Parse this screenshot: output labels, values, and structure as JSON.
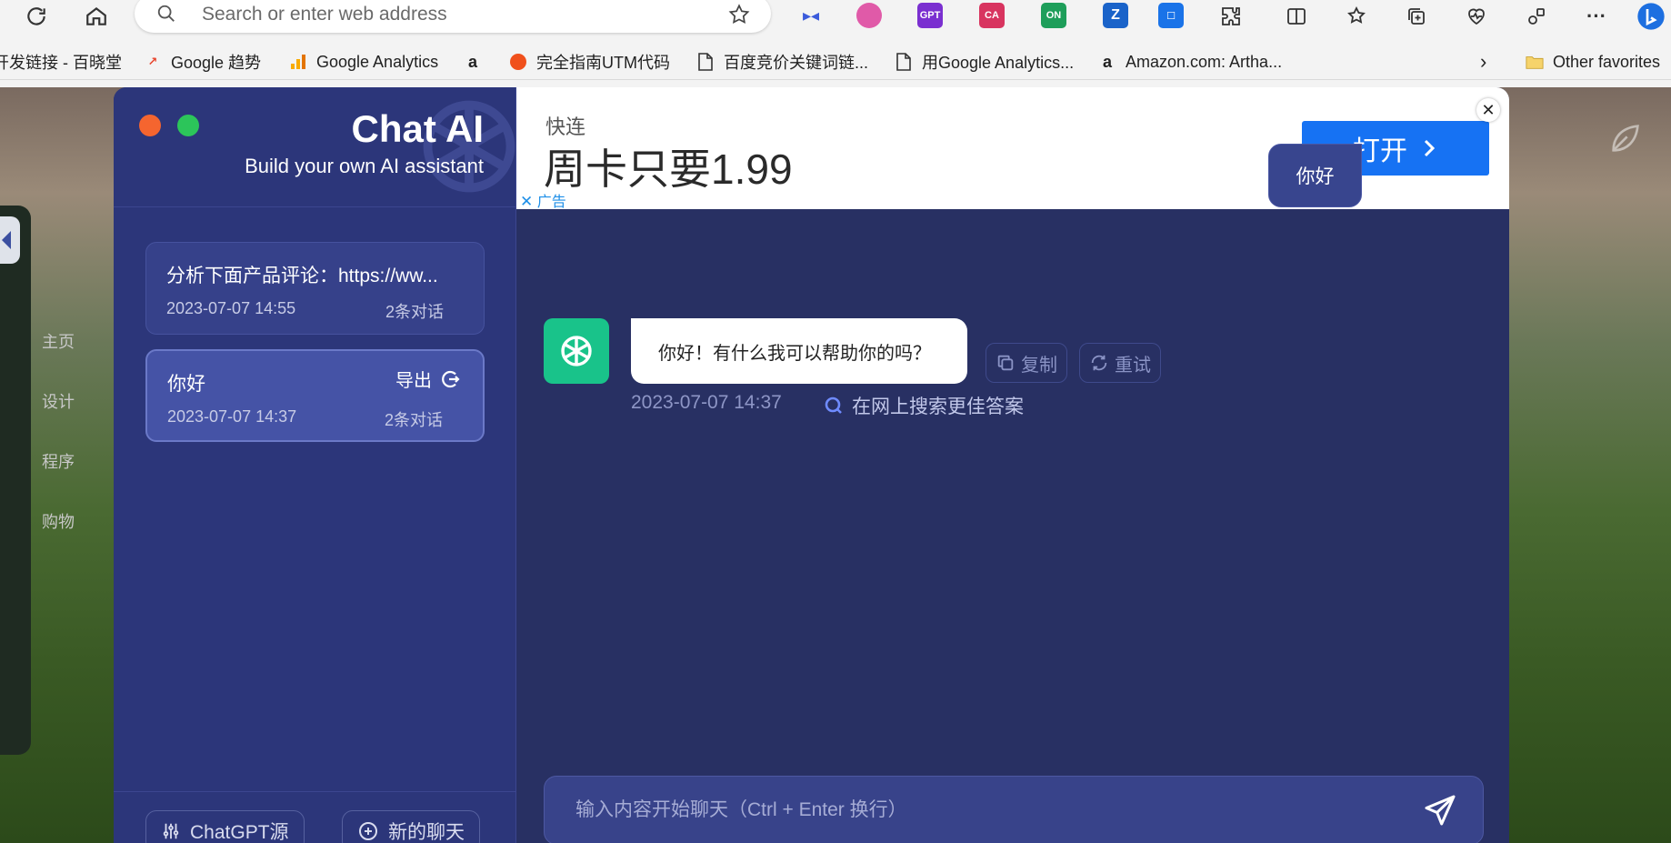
{
  "browser": {
    "address_placeholder": "Search or enter web address",
    "extensions": [
      {
        "icon": "dot-extension-icon",
        "color": "#3b5bdb"
      },
      {
        "icon": "brain-extension-icon",
        "color": "#e05aa8"
      },
      {
        "icon": "chatgpt-extension-icon",
        "color": "#7a2fd0",
        "label": "GPT"
      },
      {
        "icon": "translate-extension-icon",
        "color": "#d8345f",
        "label": "CA"
      },
      {
        "icon": "on-extension-icon",
        "color": "#1e9e5a",
        "label": "ON"
      },
      {
        "icon": "z-extension-icon",
        "color": "#1a63c9",
        "label": "Z"
      },
      {
        "icon": "chat-extension-icon",
        "color": "#1a73e8"
      }
    ],
    "bookmarks": [
      {
        "icon": "",
        "label": "开发链接 - 百晓堂"
      },
      {
        "icon": "trends-icon",
        "label": "Google 趋势"
      },
      {
        "icon": "analytics-icon",
        "label": "Google Analytics"
      },
      {
        "icon": "amazon-icon",
        "label": ""
      },
      {
        "icon": "utm-icon",
        "label": "完全指南UTM代码"
      },
      {
        "icon": "page-icon",
        "label": "百度竞价关键词链..."
      },
      {
        "icon": "page-icon",
        "label": "用Google Analytics..."
      },
      {
        "icon": "amazon-icon",
        "label": "Amazon.com: Artha..."
      }
    ],
    "other_favorites": "Other favorites"
  },
  "background_nav": [
    "主页",
    "设计",
    "程序",
    "购物"
  ],
  "app": {
    "title": "Chat AI",
    "subtitle": "Build your own AI assistant",
    "conversations": [
      {
        "title": "分析下面产品评论：https://ww...",
        "date": "2023-07-07 14:55",
        "count": "2条对话",
        "active": false
      },
      {
        "title": "你好",
        "date": "2023-07-07 14:37",
        "count": "2条对话",
        "active": true,
        "export_label": "导出"
      }
    ],
    "footer": {
      "source_label": "ChatGPT源",
      "new_chat_label": "新的聊天"
    }
  },
  "ad": {
    "brand": "快连",
    "headline": "周卡只要1.99",
    "open_label": "打开",
    "close_label": "✕",
    "tag": "广告"
  },
  "chat": {
    "user_message": "你好",
    "bot_message": "你好！有什么我可以帮助你的吗？",
    "copy_label": "复制",
    "retry_label": "重试",
    "timestamp": "2023-07-07 14:37",
    "search_label": "在网上搜索更佳答案",
    "input_placeholder": "输入内容开始聊天（Ctrl + Enter 换行）"
  },
  "colors": {
    "window_close_dot": "#f5652f",
    "window_max_dot": "#2cc55a",
    "ad_button": "#1672f3",
    "bot_avatar": "#19c38a",
    "sidebar": "#2c367a",
    "chat_bg": "#283063"
  }
}
